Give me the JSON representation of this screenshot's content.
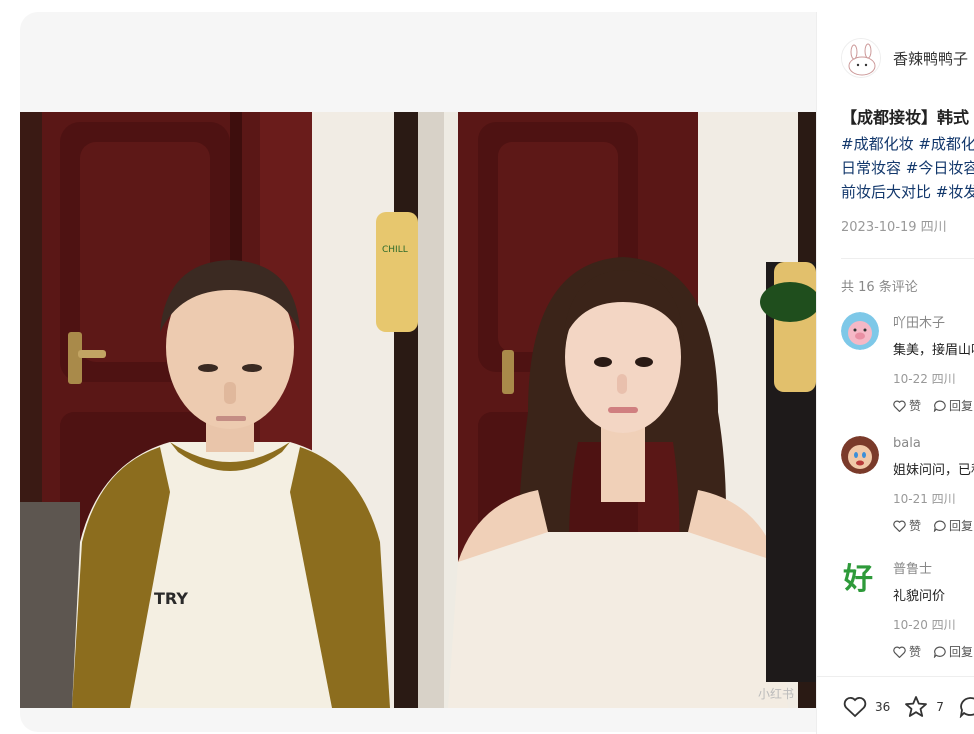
{
  "author": {
    "name": "香辣鸭鸭子"
  },
  "note": {
    "title": "【成都接妆】韩式",
    "tags": [
      "#成都化妆 #成都化",
      "日常妆容 #今日妆容",
      "前妆后大对比 #妆发"
    ],
    "date": "2023-10-19 四川"
  },
  "comments_header": "共 16 条评论",
  "comments": [
    {
      "name": "吖田木子",
      "text": "集美，接眉山吗",
      "meta": "10-22 四川",
      "like": "赞",
      "reply": "回复"
    },
    {
      "name": "bala",
      "text": "姐妹问问，已私",
      "meta": "10-21 四川",
      "like": "赞",
      "reply": "回复"
    },
    {
      "name": "普鲁士",
      "text": "礼貌问价",
      "meta": "10-20 四川",
      "like": "赞",
      "reply": "回复"
    }
  ],
  "engagement": {
    "likes": "36",
    "collects": "7"
  },
  "image": {
    "watermark": "小红书",
    "shirt_logo": "TRY",
    "phone_case_text": "CHILL"
  },
  "avatar_glyph": "好",
  "colors": {
    "tag": "#13386c",
    "door": "#5a1716",
    "wall": "#f3efe6"
  }
}
